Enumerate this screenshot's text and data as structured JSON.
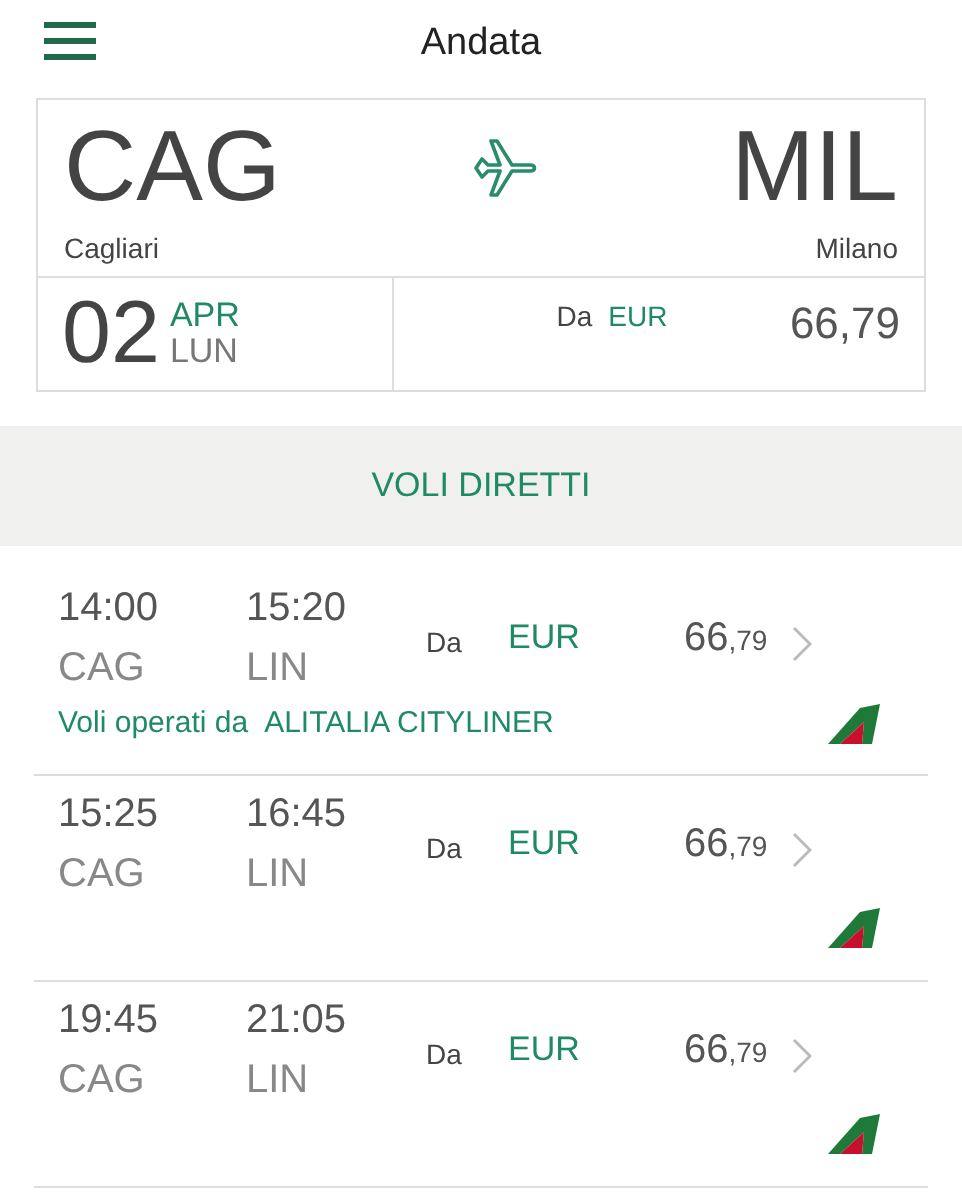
{
  "header": {
    "title": "Andata"
  },
  "summary": {
    "origin_code": "CAG",
    "origin_city": "Cagliari",
    "destination_code": "MIL",
    "destination_city": "Milano",
    "day": "02",
    "month": "APR",
    "weekday": "LUN",
    "from_label": "Da",
    "currency": "EUR",
    "price": "66,79"
  },
  "section": {
    "title": "VOLI DIRETTI"
  },
  "flights": [
    {
      "depart_time": "14:00",
      "arrive_time": "15:20",
      "depart_code": "CAG",
      "arrive_code": "LIN",
      "from_label": "Da",
      "currency": "EUR",
      "price": "66",
      "cents": ",79",
      "operator_label": "Voli operati da",
      "operator": "ALITALIA CITYLINER"
    },
    {
      "depart_time": "15:25",
      "arrive_time": "16:45",
      "depart_code": "CAG",
      "arrive_code": "LIN",
      "from_label": "Da",
      "currency": "EUR",
      "price": "66",
      "cents": ",79"
    },
    {
      "depart_time": "19:45",
      "arrive_time": "21:05",
      "depart_code": "CAG",
      "arrive_code": "LIN",
      "from_label": "Da",
      "currency": "EUR",
      "price": "66",
      "cents": ",79"
    }
  ]
}
